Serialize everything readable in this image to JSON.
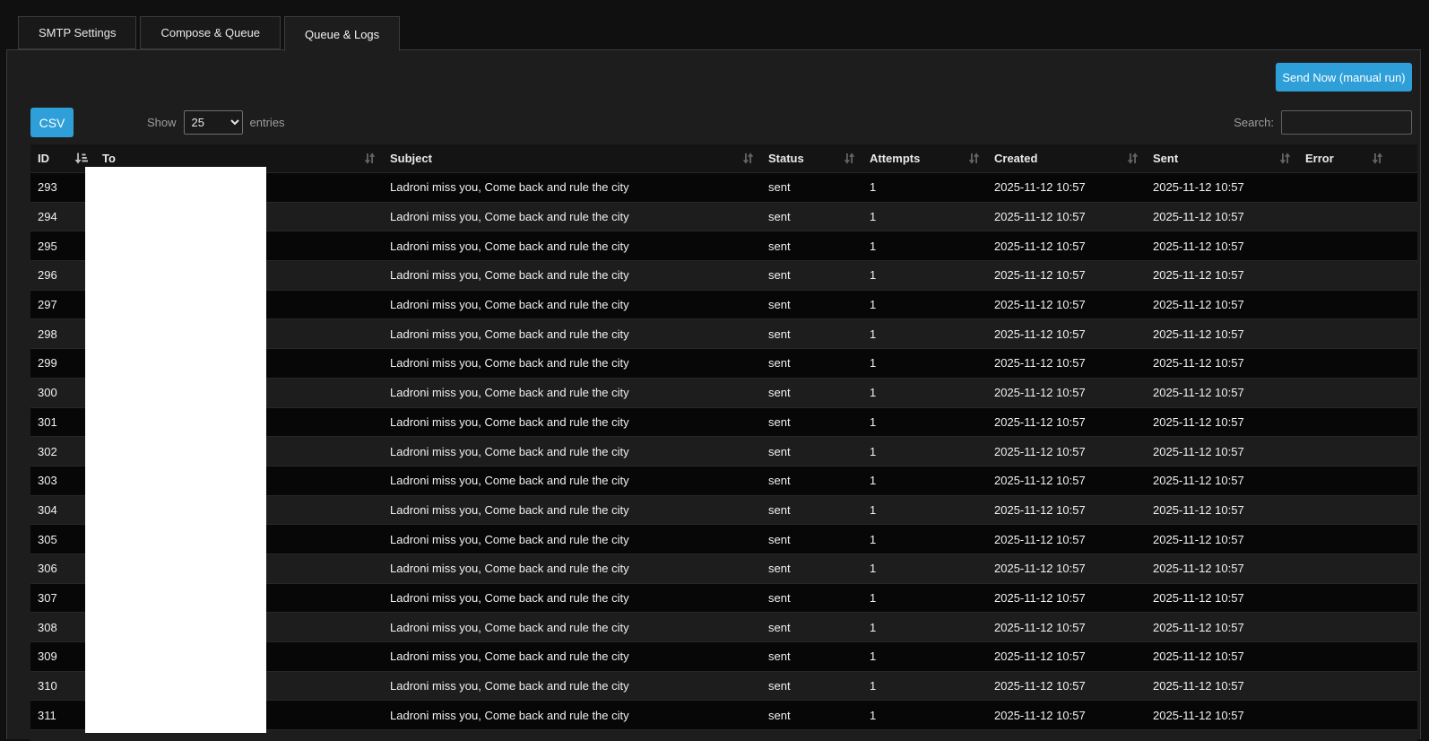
{
  "colors": {
    "accent": "#2e9fd8"
  },
  "tabs": [
    {
      "label": "SMTP Settings",
      "active": false
    },
    {
      "label": "Compose & Queue",
      "active": false
    },
    {
      "label": "Queue & Logs",
      "active": true
    }
  ],
  "toolbar": {
    "send_now_label": "Send Now (manual run)",
    "csv_label": "CSV"
  },
  "length_control": {
    "prefix": "Show",
    "selected": "25",
    "suffix": "entries"
  },
  "search": {
    "label": "Search:",
    "value": ""
  },
  "table": {
    "columns": [
      {
        "label": "ID",
        "sort": "asc"
      },
      {
        "label": "To",
        "sort": "both"
      },
      {
        "label": "Subject",
        "sort": "both"
      },
      {
        "label": "Status",
        "sort": "both"
      },
      {
        "label": "Attempts",
        "sort": "both"
      },
      {
        "label": "Created",
        "sort": "both"
      },
      {
        "label": "Sent",
        "sort": "both"
      },
      {
        "label": "Error",
        "sort": "both"
      }
    ],
    "rows": [
      {
        "id": "293",
        "to": "",
        "subject": "Ladroni miss you, Come back and rule the city",
        "status": "sent",
        "attempts": "1",
        "created": "2025-11-12 10:57",
        "sent": "2025-11-12 10:57",
        "error": ""
      },
      {
        "id": "294",
        "to": "",
        "subject": "Ladroni miss you, Come back and rule the city",
        "status": "sent",
        "attempts": "1",
        "created": "2025-11-12 10:57",
        "sent": "2025-11-12 10:57",
        "error": ""
      },
      {
        "id": "295",
        "to": "",
        "subject": "Ladroni miss you, Come back and rule the city",
        "status": "sent",
        "attempts": "1",
        "created": "2025-11-12 10:57",
        "sent": "2025-11-12 10:57",
        "error": ""
      },
      {
        "id": "296",
        "to": "",
        "subject": "Ladroni miss you, Come back and rule the city",
        "status": "sent",
        "attempts": "1",
        "created": "2025-11-12 10:57",
        "sent": "2025-11-12 10:57",
        "error": ""
      },
      {
        "id": "297",
        "to": "",
        "subject": "Ladroni miss you, Come back and rule the city",
        "status": "sent",
        "attempts": "1",
        "created": "2025-11-12 10:57",
        "sent": "2025-11-12 10:57",
        "error": ""
      },
      {
        "id": "298",
        "to": "",
        "subject": "Ladroni miss you, Come back and rule the city",
        "status": "sent",
        "attempts": "1",
        "created": "2025-11-12 10:57",
        "sent": "2025-11-12 10:57",
        "error": ""
      },
      {
        "id": "299",
        "to": "",
        "subject": "Ladroni miss you, Come back and rule the city",
        "status": "sent",
        "attempts": "1",
        "created": "2025-11-12 10:57",
        "sent": "2025-11-12 10:57",
        "error": ""
      },
      {
        "id": "300",
        "to": "",
        "subject": "Ladroni miss you, Come back and rule the city",
        "status": "sent",
        "attempts": "1",
        "created": "2025-11-12 10:57",
        "sent": "2025-11-12 10:57",
        "error": ""
      },
      {
        "id": "301",
        "to": "",
        "subject": "Ladroni miss you, Come back and rule the city",
        "status": "sent",
        "attempts": "1",
        "created": "2025-11-12 10:57",
        "sent": "2025-11-12 10:57",
        "error": ""
      },
      {
        "id": "302",
        "to": "",
        "subject": "Ladroni miss you, Come back and rule the city",
        "status": "sent",
        "attempts": "1",
        "created": "2025-11-12 10:57",
        "sent": "2025-11-12 10:57",
        "error": ""
      },
      {
        "id": "303",
        "to": "",
        "subject": "Ladroni miss you, Come back and rule the city",
        "status": "sent",
        "attempts": "1",
        "created": "2025-11-12 10:57",
        "sent": "2025-11-12 10:57",
        "error": ""
      },
      {
        "id": "304",
        "to": "",
        "subject": "Ladroni miss you, Come back and rule the city",
        "status": "sent",
        "attempts": "1",
        "created": "2025-11-12 10:57",
        "sent": "2025-11-12 10:57",
        "error": ""
      },
      {
        "id": "305",
        "to": "",
        "subject": "Ladroni miss you, Come back and rule the city",
        "status": "sent",
        "attempts": "1",
        "created": "2025-11-12 10:57",
        "sent": "2025-11-12 10:57",
        "error": ""
      },
      {
        "id": "306",
        "to": "",
        "subject": "Ladroni miss you, Come back and rule the city",
        "status": "sent",
        "attempts": "1",
        "created": "2025-11-12 10:57",
        "sent": "2025-11-12 10:57",
        "error": ""
      },
      {
        "id": "307",
        "to": "",
        "subject": "Ladroni miss you, Come back and rule the city",
        "status": "sent",
        "attempts": "1",
        "created": "2025-11-12 10:57",
        "sent": "2025-11-12 10:57",
        "error": ""
      },
      {
        "id": "308",
        "to": "",
        "subject": "Ladroni miss you, Come back and rule the city",
        "status": "sent",
        "attempts": "1",
        "created": "2025-11-12 10:57",
        "sent": "2025-11-12 10:57",
        "error": ""
      },
      {
        "id": "309",
        "to": "",
        "subject": "Ladroni miss you, Come back and rule the city",
        "status": "sent",
        "attempts": "1",
        "created": "2025-11-12 10:57",
        "sent": "2025-11-12 10:57",
        "error": ""
      },
      {
        "id": "310",
        "to": "",
        "subject": "Ladroni miss you, Come back and rule the city",
        "status": "sent",
        "attempts": "1",
        "created": "2025-11-12 10:57",
        "sent": "2025-11-12 10:57",
        "error": ""
      },
      {
        "id": "311",
        "to": "",
        "subject": "Ladroni miss you, Come back and rule the city",
        "status": "sent",
        "attempts": "1",
        "created": "2025-11-12 10:57",
        "sent": "2025-11-12 10:57",
        "error": ""
      }
    ]
  }
}
